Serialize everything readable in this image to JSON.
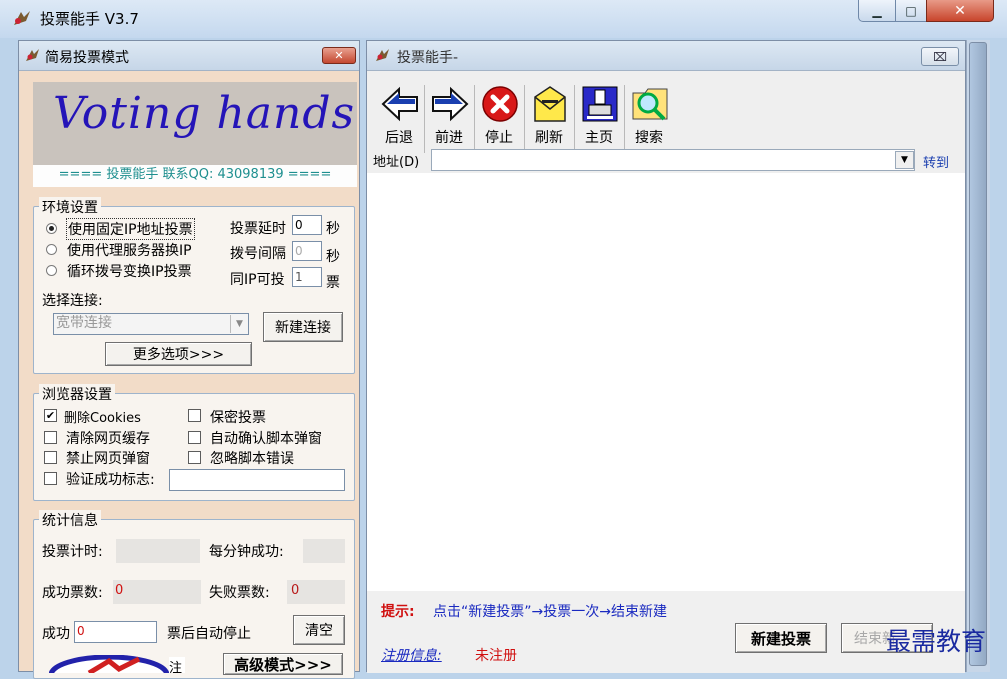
{
  "window": {
    "title": "投票能手 V3.7",
    "min_symbol": "▁",
    "max_symbol": "□",
    "close_symbol": "✕"
  },
  "left_panel": {
    "title": "简易投票模式",
    "close_symbol": "✕",
    "banner": {
      "text": "Voting hands",
      "subtitle": "==== 投票能手 联系QQ: 43098139 ===="
    },
    "env": {
      "title": "环境设置",
      "options": [
        {
          "label": "使用固定IP地址投票",
          "selected": true
        },
        {
          "label": "使用代理服务器换IP",
          "selected": false
        },
        {
          "label": "循环拨号变换IP投票",
          "selected": false
        }
      ],
      "vote_delay_label": "投票延时",
      "vote_delay_value": "0",
      "vote_delay_unit": "秒",
      "dial_interval_label": "拨号间隔",
      "dial_interval_value": "0",
      "dial_interval_unit": "秒",
      "same_ip_label": "同IP可投",
      "same_ip_value": "1",
      "same_ip_unit": "票",
      "select_conn_label": "选择连接:",
      "conn_value": "宽带连接",
      "new_conn_button": "新建连接",
      "more_options_button": "更多选项>>>"
    },
    "browser": {
      "title": "浏览器设置",
      "checks": [
        {
          "label": "删除Cookies",
          "checked": true
        },
        {
          "label": "保密投票",
          "checked": false
        },
        {
          "label": "清除网页缓存",
          "checked": false
        },
        {
          "label": "自动确认脚本弹窗",
          "checked": false
        },
        {
          "label": "禁止网页弹窗",
          "checked": false
        },
        {
          "label": "忽略脚本错误",
          "checked": false
        },
        {
          "label": "验证成功标志:",
          "checked": false
        }
      ]
    },
    "stats": {
      "title": "统计信息",
      "timer_label": "投票计时:",
      "per_min_label": "每分钟成功:",
      "success_label": "成功票数:",
      "success_value": "0",
      "fail_label": "失败票数:",
      "fail_value": "0",
      "auto_stop_prefix": "成功",
      "auto_stop_value": "0",
      "auto_stop_suffix": "票后自动停止",
      "clear_button": "清空",
      "bottom_partial_label": "注",
      "advanced_button": "高级模式>>>"
    }
  },
  "right_panel": {
    "title": "投票能手-",
    "close_symbol": "⌧",
    "toolbar": [
      {
        "label": "后退",
        "icon": "back-arrow-icon"
      },
      {
        "label": "前进",
        "icon": "forward-arrow-icon"
      },
      {
        "label": "停止",
        "icon": "stop-icon"
      },
      {
        "label": "刷新",
        "icon": "refresh-icon"
      },
      {
        "label": "主页",
        "icon": "home-icon"
      },
      {
        "label": "搜索",
        "icon": "search-icon"
      }
    ],
    "address_label": "地址(D)",
    "address_value": "",
    "go_label": "转到",
    "hint_label": "提示:",
    "hint_text": "点击“新建投票”→投票一次→结束新建",
    "reg_label": "注册信息:",
    "reg_value": "未注册",
    "new_vote_button": "新建投票",
    "end_button": "结束新"
  },
  "watermark": "最需教育",
  "colors": {
    "accent_red": "#d01010",
    "link_blue": "#1c40b0",
    "panel_bg": "#f2dcc8"
  }
}
